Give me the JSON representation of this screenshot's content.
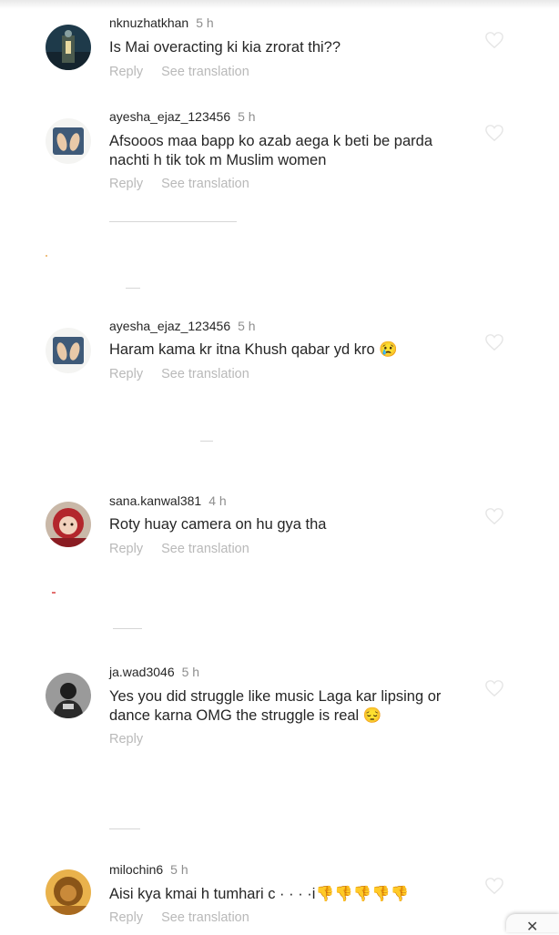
{
  "comments": [
    {
      "username": "nknuzhatkhan",
      "time": "5 h",
      "text": "Is Mai overacting ki kia zrorat thi??",
      "reply": "Reply",
      "translate": "See translation",
      "avatar": "dark-building-avatar"
    },
    {
      "username": "ayesha_ejaz_123456",
      "time": "5 h",
      "text": "Afsooos maa bapp ko azab aega k beti be parda nachti h tik tok m Muslim women",
      "reply": "Reply",
      "translate": "See translation",
      "avatar": "praying-hands-avatar"
    },
    {
      "username": "ayesha_ejaz_123456",
      "time": "5 h",
      "text": "Haram kama kr itna Khush qabar yd kro 😢",
      "reply": "Reply",
      "translate": "See translation",
      "avatar": "praying-hands-avatar"
    },
    {
      "username": "sana.kanwal381",
      "time": "4 h",
      "text": "Roty huay camera on hu gya tha",
      "reply": "Reply",
      "translate": "See translation",
      "avatar": "child-red-scarf-avatar"
    },
    {
      "username": "ja.wad3046",
      "time": "5 h",
      "text": "Yes you did struggle like music Laga kar lipsing or dance karna OMG the struggle is real 😔",
      "reply": "Reply",
      "translate": "",
      "avatar": "dark-person-avatar"
    },
    {
      "username": "milochin6",
      "time": "5 h",
      "text": "Aisi kya kmai h tumhari c  ·  ·  ·  ·i👎👎👎👎👎",
      "reply": "Reply",
      "translate": "See translation",
      "avatar": "lion-avatar"
    }
  ],
  "icons": {
    "like": "heart-outline-icon",
    "close": "close-icon"
  },
  "colors": {
    "text": "#262626",
    "muted": "#8e8e8e",
    "action": "#b9b9b9"
  }
}
